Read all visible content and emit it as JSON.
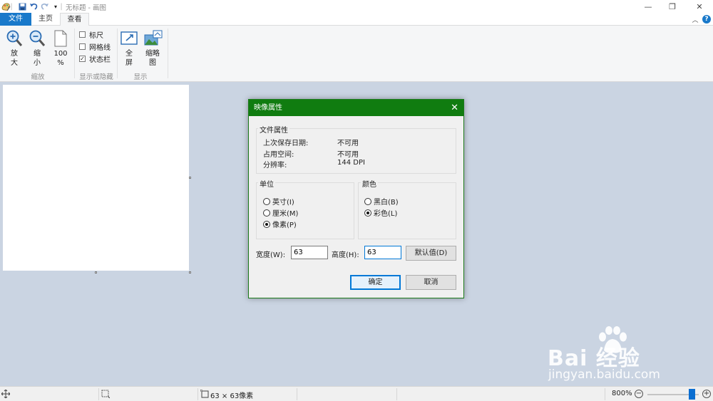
{
  "window": {
    "title": "无标题 - 画图",
    "minimize_glyph": "—",
    "restore_glyph": "❐",
    "close_glyph": "✕"
  },
  "quick_access": {
    "app_icon": "paint-palette-icon",
    "save_icon": "save-icon",
    "undo_icon": "undo-icon",
    "redo_icon": "redo-icon",
    "customize_glyph": "▾"
  },
  "tabs": {
    "file": "文件",
    "home": "主页",
    "view": "查看",
    "collapse_glyph": "︿",
    "help_glyph": "?"
  },
  "ribbon": {
    "zoom_in": "放\n大",
    "zoom_out": "缩\n小",
    "zoom_100": "100\n%",
    "zoom_group": "缩放",
    "ruler": "标尺",
    "gridlines": "网格线",
    "statusbar": "状态栏",
    "ruler_checked": false,
    "gridlines_checked": false,
    "statusbar_checked": true,
    "show_hide_group": "显示或隐藏",
    "fullscreen": "全\n屏",
    "thumbnail": "缩略\n图",
    "display_group": "显示"
  },
  "dialog": {
    "title": "映像属性",
    "close_glyph": "✕",
    "file_props": {
      "heading": "文件属性",
      "saved_label": "上次保存日期:",
      "saved_value": "不可用",
      "size_label": "占用空间:",
      "size_value": "不可用",
      "resolution_label": "分辨率:",
      "resolution_value": "144 DPI"
    },
    "units": {
      "heading": "单位",
      "inches": "英寸(I)",
      "cm": "厘米(M)",
      "pixels": "像素(P)",
      "selected": "pixels"
    },
    "colors": {
      "heading": "颜色",
      "bw": "黑白(B)",
      "color": "彩色(L)",
      "selected": "color"
    },
    "width_label": "宽度(W):",
    "width_value": "63",
    "height_label": "高度(H):",
    "height_value": "63",
    "default_button": "默认值(D)",
    "ok_button": "确定",
    "cancel_button": "取消"
  },
  "statusbar": {
    "dimensions": "63 × 63像素",
    "zoom": "800%",
    "zoom_level_fraction": 0.8,
    "minus": "−",
    "plus": "+"
  },
  "watermark": {
    "logo": "Bai 经验",
    "site": "jingyan.baidu.com"
  },
  "colors": {
    "file_tab": "#1979ca",
    "dialog_title": "#107c10",
    "workspace": "#cad4e2",
    "slider": "#0a6ed1"
  }
}
